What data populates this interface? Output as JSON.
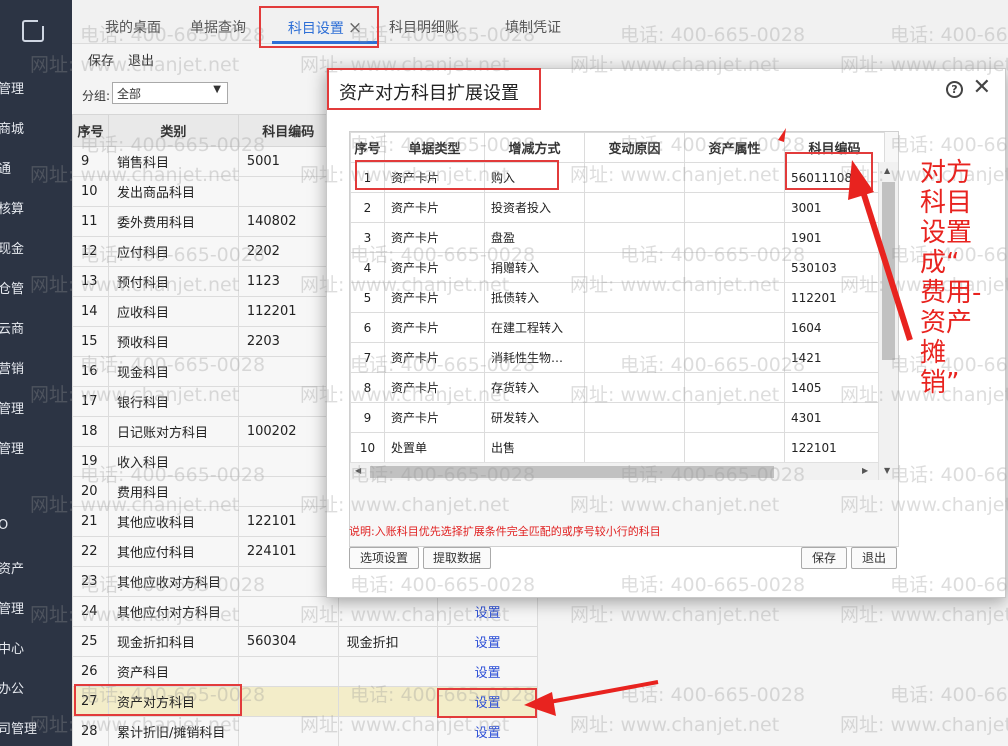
{
  "nav": {
    "items": [
      "管理",
      "商城",
      "通",
      "核算",
      "现金",
      "仓管",
      "云商",
      "营销",
      "管理",
      "管理",
      "O",
      "资产",
      "管理",
      "中心",
      "办公",
      "司管理"
    ]
  },
  "tabs": [
    {
      "label": "我的桌面"
    },
    {
      "label": "单据查询"
    },
    {
      "label": "科目设置",
      "close": "×"
    },
    {
      "label": "科目明细账"
    },
    {
      "label": "填制凭证"
    }
  ],
  "toolbar": {
    "save": "保存",
    "exit": "退出"
  },
  "group": {
    "label": "分组:",
    "value": "全部"
  },
  "main_table": {
    "headers": [
      "序号",
      "类别",
      "科目编码"
    ],
    "rows": [
      {
        "seq": "9",
        "name": "销售科目",
        "code": "5001",
        "extra": "",
        "action": ""
      },
      {
        "seq": "10",
        "name": "发出商品科目",
        "code": "",
        "extra": "",
        "action": ""
      },
      {
        "seq": "11",
        "name": "委外费用科目",
        "code": "140802",
        "extra": "",
        "action": ""
      },
      {
        "seq": "12",
        "name": "应付科目",
        "code": "2202",
        "extra": "",
        "action": ""
      },
      {
        "seq": "13",
        "name": "预付科目",
        "code": "1123",
        "extra": "",
        "action": ""
      },
      {
        "seq": "14",
        "name": "应收科目",
        "code": "112201",
        "extra": "",
        "action": ""
      },
      {
        "seq": "15",
        "name": "预收科目",
        "code": "2203",
        "extra": "",
        "action": ""
      },
      {
        "seq": "16",
        "name": "现金科目",
        "code": "",
        "extra": "",
        "action": ""
      },
      {
        "seq": "17",
        "name": "银行科目",
        "code": "",
        "extra": "",
        "action": ""
      },
      {
        "seq": "18",
        "name": "日记账对方科目",
        "code": "100202",
        "extra": "",
        "action": ""
      },
      {
        "seq": "19",
        "name": "收入科目",
        "code": "",
        "extra": "",
        "action": ""
      },
      {
        "seq": "20",
        "name": "费用科目",
        "code": "",
        "extra": "",
        "action": ""
      },
      {
        "seq": "21",
        "name": "其他应收科目",
        "code": "122101",
        "extra": "",
        "action": ""
      },
      {
        "seq": "22",
        "name": "其他应付科目",
        "code": "224101",
        "extra": "",
        "action": ""
      },
      {
        "seq": "23",
        "name": "其他应收对方科目",
        "code": "",
        "extra": "",
        "action": ""
      },
      {
        "seq": "24",
        "name": "其他应付对方科目",
        "code": "",
        "extra": "",
        "action": "设置"
      },
      {
        "seq": "25",
        "name": "现金折扣科目",
        "code": "560304",
        "extra": "现金折扣",
        "action": "设置"
      },
      {
        "seq": "26",
        "name": "资产科目",
        "code": "",
        "extra": "",
        "action": "设置"
      },
      {
        "seq": "27",
        "name": "资产对方科目",
        "code": "",
        "extra": "",
        "action": "设置"
      },
      {
        "seq": "28",
        "name": "累计折旧/摊销科目",
        "code": "",
        "extra": "",
        "action": "设置"
      }
    ]
  },
  "modal": {
    "title": "资产对方科目扩展设置",
    "headers": [
      "序号",
      "单据类型",
      "增减方式",
      "变动原因",
      "资产属性",
      "科目编码"
    ],
    "rows": [
      {
        "seq": "1",
        "doc": "资产卡片",
        "method": "购入",
        "reason": "",
        "attr": "",
        "code": "56011108"
      },
      {
        "seq": "2",
        "doc": "资产卡片",
        "method": "投资者投入",
        "reason": "",
        "attr": "",
        "code": "3001"
      },
      {
        "seq": "3",
        "doc": "资产卡片",
        "method": "盘盈",
        "reason": "",
        "attr": "",
        "code": "1901"
      },
      {
        "seq": "4",
        "doc": "资产卡片",
        "method": "捐赠转入",
        "reason": "",
        "attr": "",
        "code": "530103"
      },
      {
        "seq": "5",
        "doc": "资产卡片",
        "method": "抵债转入",
        "reason": "",
        "attr": "",
        "code": "112201"
      },
      {
        "seq": "6",
        "doc": "资产卡片",
        "method": "在建工程转入",
        "reason": "",
        "attr": "",
        "code": "1604"
      },
      {
        "seq": "7",
        "doc": "资产卡片",
        "method": "消耗性生物…",
        "reason": "",
        "attr": "",
        "code": "1421"
      },
      {
        "seq": "8",
        "doc": "资产卡片",
        "method": "存货转入",
        "reason": "",
        "attr": "",
        "code": "1405"
      },
      {
        "seq": "9",
        "doc": "资产卡片",
        "method": "研发转入",
        "reason": "",
        "attr": "",
        "code": "4301"
      },
      {
        "seq": "10",
        "doc": "处置单",
        "method": "出售",
        "reason": "",
        "attr": "",
        "code": "122101"
      }
    ],
    "ellipsis": "…",
    "note": "说明:入账科目优先选择扩展条件完全匹配的或序号较小行的科目",
    "btn_options": "选项设置",
    "btn_fetch": "提取数据",
    "btn_save": "保存",
    "btn_exit": "退出"
  },
  "annotation": {
    "text": "对方科目设置成“费用-资产摊销”",
    "lines": [
      "对方",
      "科目",
      "设置",
      "成“",
      "费用-",
      "资产",
      "摊",
      "销”"
    ],
    "color": "#e8231f"
  },
  "watermark": {
    "phone": "电话: 400-665-0028",
    "site": "网址: www.chanjet.net"
  }
}
